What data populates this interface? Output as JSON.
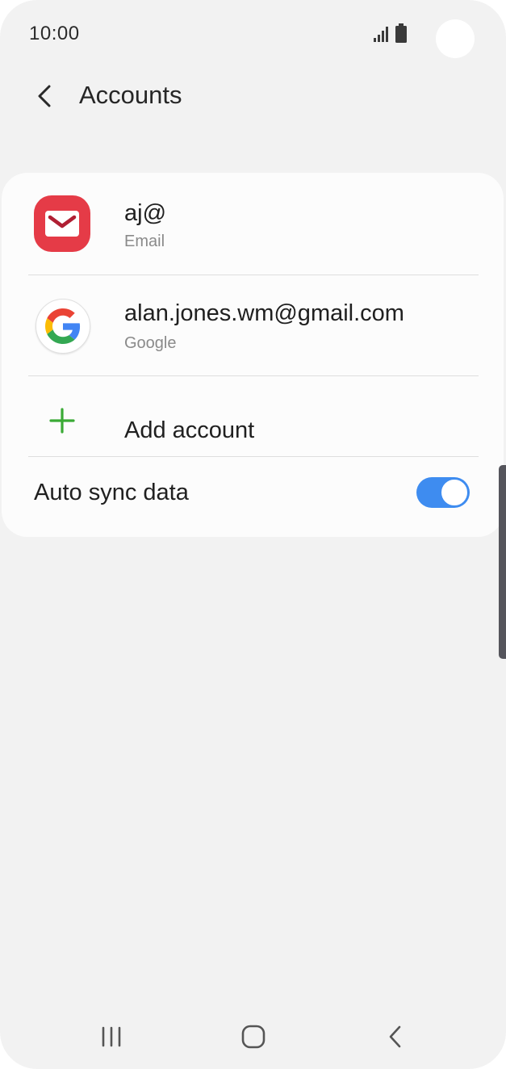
{
  "status_bar": {
    "time": "10:00",
    "icons": [
      "signal-icon",
      "battery-icon",
      "camera-cutout"
    ]
  },
  "header": {
    "back_icon": "chevron-left-icon",
    "title": "Accounts"
  },
  "accounts": [
    {
      "title": "aj@",
      "subtitle": "Email",
      "icon": "email-app-icon",
      "icon_color": "#e53b47"
    },
    {
      "title": "alan.jones.wm@gmail.com",
      "subtitle": "Google",
      "icon": "google-icon"
    }
  ],
  "add_account": {
    "label": "Add account",
    "icon": "plus-icon",
    "icon_color": "#3aaa35"
  },
  "auto_sync": {
    "label": "Auto sync data",
    "enabled": true,
    "toggle_color": "#3e8cf0"
  },
  "nav_bar": {
    "buttons": [
      "recent-apps-icon",
      "home-icon",
      "back-icon"
    ]
  }
}
